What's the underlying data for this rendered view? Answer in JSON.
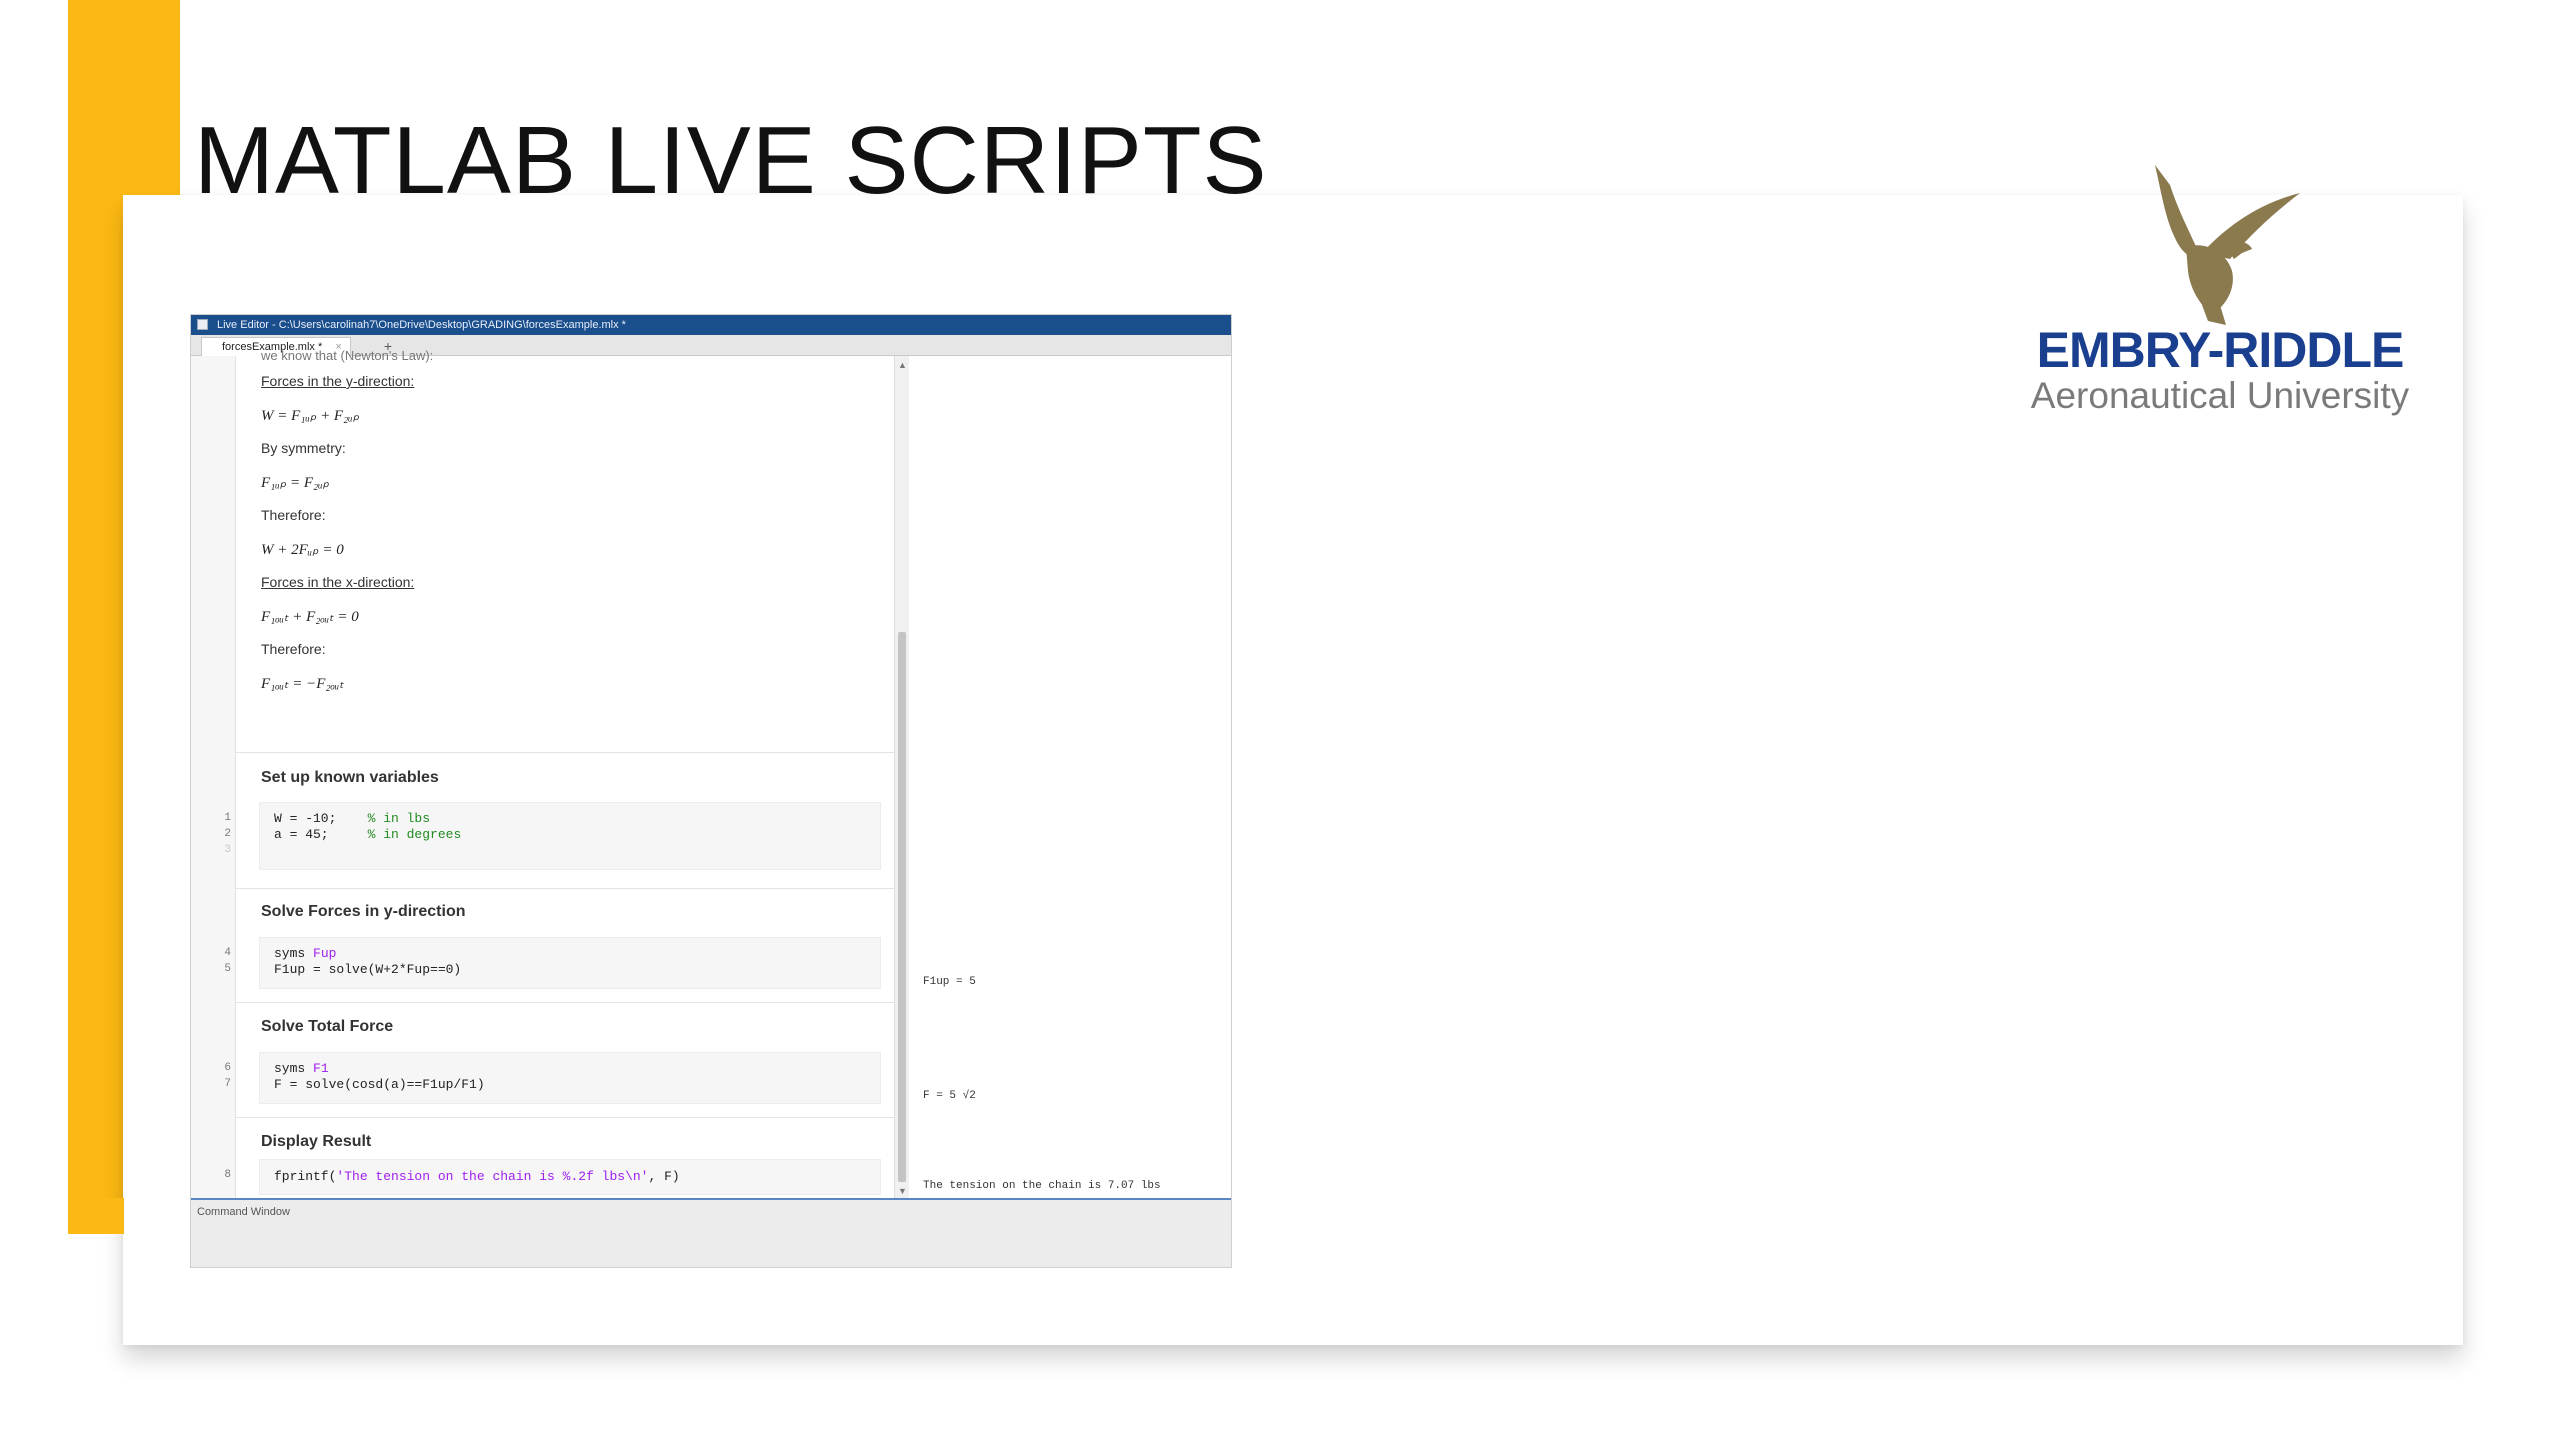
{
  "slide": {
    "title": "MATLAB LIVE SCRIPTS",
    "accent_color": "#FDB913"
  },
  "logo": {
    "wordmark": "EMBRY-RIDDLE",
    "subline": "Aeronautical University",
    "icon": "eagle-icon",
    "wordmark_color": "#1B3F8F",
    "eagle_color": "#8C7A4F"
  },
  "editor": {
    "window_title": "Live Editor - C:\\Users\\carolinah7\\OneDrive\\Desktop\\GRADING\\forcesExample.mlx *",
    "tab_label": "forcesExample.mlx *",
    "tab_close": "×",
    "tab_add": "+",
    "text_cells": {
      "clipped_top": "we know that (Newton's Law):",
      "forces_y_heading": "Forces in the y-direction:",
      "eq1": "W = F₁ᵤₚ + F₂ᵤₚ",
      "by_symmetry": "By symmetry:",
      "eq2": "F₁ᵤₚ = F₂ᵤₚ",
      "therefore1": "Therefore:",
      "eq3": "W + 2Fᵤₚ = 0",
      "forces_x_heading": "Forces in the x-direction:",
      "eq4": "F₁ₒᵤₜ + F₂ₒᵤₜ = 0",
      "therefore2": "Therefore:",
      "eq5": "F₁ₒᵤₜ = −F₂ₒᵤₜ"
    },
    "sections": [
      {
        "heading": "Set up known variables",
        "lines": [
          {
            "num": "1",
            "code": "W = -10;    ",
            "comment": "% in lbs"
          },
          {
            "num": "2",
            "code": "a = 45;     ",
            "comment": "% in degrees"
          }
        ],
        "extra_line_num": "3"
      },
      {
        "heading": "Solve Forces in y-direction",
        "lines": [
          {
            "num": "4",
            "code": "syms ",
            "arg": "Fup"
          },
          {
            "num": "5",
            "code": "F1up = solve(W+2*Fup==0)"
          }
        ]
      },
      {
        "heading": "Solve Total Force",
        "lines": [
          {
            "num": "6",
            "code": "syms ",
            "arg": "F1"
          },
          {
            "num": "7",
            "code": "F = solve(cosd(a)==F1up/F1)"
          }
        ]
      },
      {
        "heading": "Display Result",
        "lines": [
          {
            "num": "8",
            "code": "fprintf(",
            "string": "'The tension on the chain is %.2f lbs\\n'",
            "tail": ", F)"
          }
        ]
      }
    ],
    "outputs": {
      "out1": "F1up = 5",
      "out2": "F = 5 √2",
      "out3": "The tension on the chain is 7.07 lbs"
    },
    "command_window_label": "Command Window"
  }
}
